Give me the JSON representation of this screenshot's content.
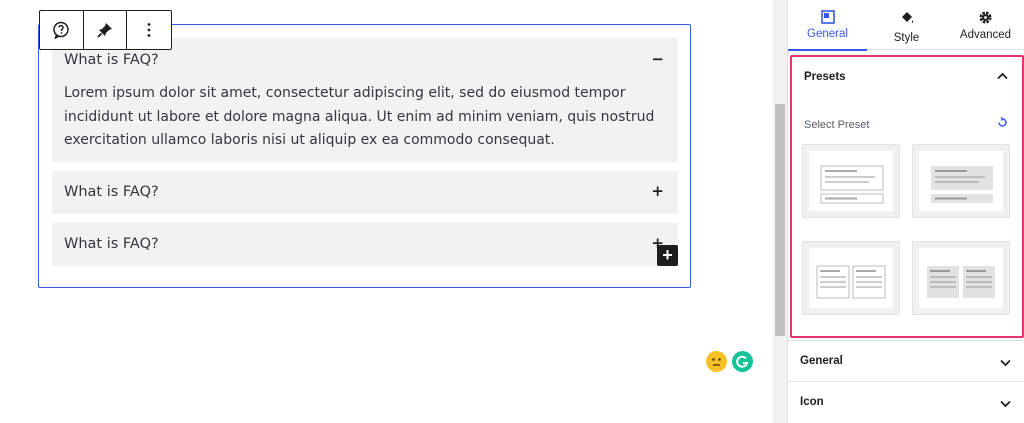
{
  "faq": {
    "items": [
      {
        "question": "What is FAQ?",
        "toggle": "−",
        "answer": "Lorem ipsum dolor sit amet, consectetur adipiscing elit, sed do eiusmod tempor incididunt ut labore et dolore magna aliqua. Ut enim ad minim veniam, quis nostrud exercitation ullamco laboris nisi ut aliquip ex ea commodo consequat."
      },
      {
        "question": "What is FAQ?",
        "toggle": "+"
      },
      {
        "question": "What is FAQ?",
        "toggle": "+"
      }
    ],
    "add_block": "+"
  },
  "toolbar": {
    "icons": [
      "faq-block-icon",
      "pin-icon",
      "more-options-icon"
    ]
  },
  "sidebar": {
    "tabs": [
      {
        "label": "General",
        "icon": "layout-icon",
        "active": true
      },
      {
        "label": "Style",
        "icon": "paint-bucket-icon",
        "active": false
      },
      {
        "label": "Advanced",
        "icon": "gear-icon",
        "active": false
      }
    ],
    "presets": {
      "title": "Presets",
      "select_label": "Select Preset",
      "options": [
        "preset-1",
        "preset-2",
        "preset-3",
        "preset-4"
      ]
    },
    "sections": [
      {
        "title": "General"
      },
      {
        "title": "Icon"
      }
    ]
  },
  "colors": {
    "accent": "#3858e9",
    "highlight": "#e8336d",
    "faq_background": "#f0f2f4"
  }
}
